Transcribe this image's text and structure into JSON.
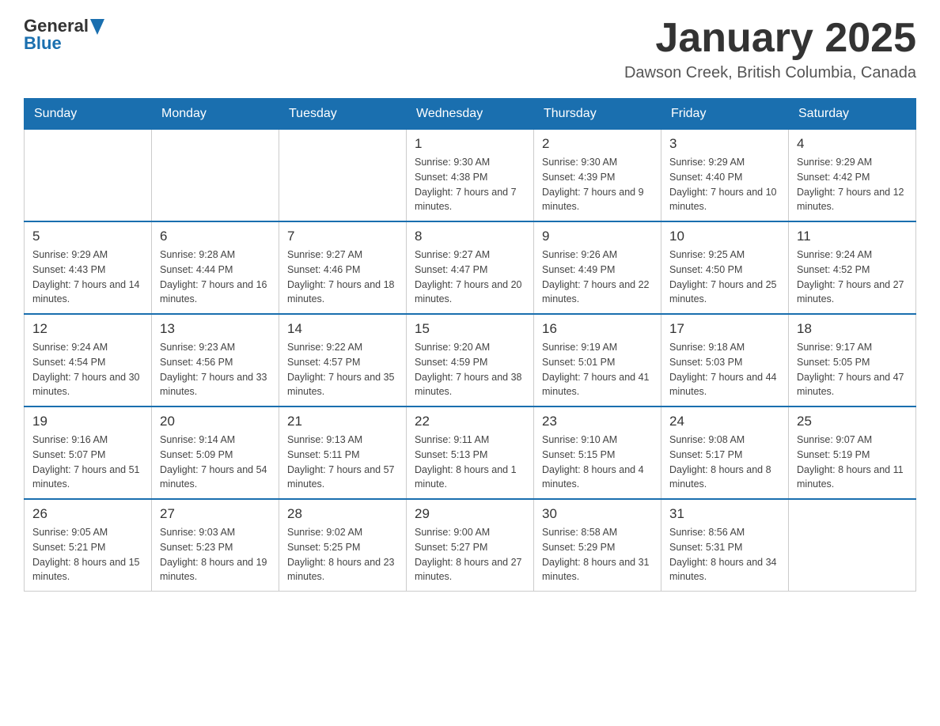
{
  "logo": {
    "text_general": "General",
    "text_blue": "Blue"
  },
  "title": "January 2025",
  "subtitle": "Dawson Creek, British Columbia, Canada",
  "days_of_week": [
    "Sunday",
    "Monday",
    "Tuesday",
    "Wednesday",
    "Thursday",
    "Friday",
    "Saturday"
  ],
  "weeks": [
    [
      {
        "num": "",
        "info": ""
      },
      {
        "num": "",
        "info": ""
      },
      {
        "num": "",
        "info": ""
      },
      {
        "num": "1",
        "info": "Sunrise: 9:30 AM\nSunset: 4:38 PM\nDaylight: 7 hours and 7 minutes."
      },
      {
        "num": "2",
        "info": "Sunrise: 9:30 AM\nSunset: 4:39 PM\nDaylight: 7 hours and 9 minutes."
      },
      {
        "num": "3",
        "info": "Sunrise: 9:29 AM\nSunset: 4:40 PM\nDaylight: 7 hours and 10 minutes."
      },
      {
        "num": "4",
        "info": "Sunrise: 9:29 AM\nSunset: 4:42 PM\nDaylight: 7 hours and 12 minutes."
      }
    ],
    [
      {
        "num": "5",
        "info": "Sunrise: 9:29 AM\nSunset: 4:43 PM\nDaylight: 7 hours and 14 minutes."
      },
      {
        "num": "6",
        "info": "Sunrise: 9:28 AM\nSunset: 4:44 PM\nDaylight: 7 hours and 16 minutes."
      },
      {
        "num": "7",
        "info": "Sunrise: 9:27 AM\nSunset: 4:46 PM\nDaylight: 7 hours and 18 minutes."
      },
      {
        "num": "8",
        "info": "Sunrise: 9:27 AM\nSunset: 4:47 PM\nDaylight: 7 hours and 20 minutes."
      },
      {
        "num": "9",
        "info": "Sunrise: 9:26 AM\nSunset: 4:49 PM\nDaylight: 7 hours and 22 minutes."
      },
      {
        "num": "10",
        "info": "Sunrise: 9:25 AM\nSunset: 4:50 PM\nDaylight: 7 hours and 25 minutes."
      },
      {
        "num": "11",
        "info": "Sunrise: 9:24 AM\nSunset: 4:52 PM\nDaylight: 7 hours and 27 minutes."
      }
    ],
    [
      {
        "num": "12",
        "info": "Sunrise: 9:24 AM\nSunset: 4:54 PM\nDaylight: 7 hours and 30 minutes."
      },
      {
        "num": "13",
        "info": "Sunrise: 9:23 AM\nSunset: 4:56 PM\nDaylight: 7 hours and 33 minutes."
      },
      {
        "num": "14",
        "info": "Sunrise: 9:22 AM\nSunset: 4:57 PM\nDaylight: 7 hours and 35 minutes."
      },
      {
        "num": "15",
        "info": "Sunrise: 9:20 AM\nSunset: 4:59 PM\nDaylight: 7 hours and 38 minutes."
      },
      {
        "num": "16",
        "info": "Sunrise: 9:19 AM\nSunset: 5:01 PM\nDaylight: 7 hours and 41 minutes."
      },
      {
        "num": "17",
        "info": "Sunrise: 9:18 AM\nSunset: 5:03 PM\nDaylight: 7 hours and 44 minutes."
      },
      {
        "num": "18",
        "info": "Sunrise: 9:17 AM\nSunset: 5:05 PM\nDaylight: 7 hours and 47 minutes."
      }
    ],
    [
      {
        "num": "19",
        "info": "Sunrise: 9:16 AM\nSunset: 5:07 PM\nDaylight: 7 hours and 51 minutes."
      },
      {
        "num": "20",
        "info": "Sunrise: 9:14 AM\nSunset: 5:09 PM\nDaylight: 7 hours and 54 minutes."
      },
      {
        "num": "21",
        "info": "Sunrise: 9:13 AM\nSunset: 5:11 PM\nDaylight: 7 hours and 57 minutes."
      },
      {
        "num": "22",
        "info": "Sunrise: 9:11 AM\nSunset: 5:13 PM\nDaylight: 8 hours and 1 minute."
      },
      {
        "num": "23",
        "info": "Sunrise: 9:10 AM\nSunset: 5:15 PM\nDaylight: 8 hours and 4 minutes."
      },
      {
        "num": "24",
        "info": "Sunrise: 9:08 AM\nSunset: 5:17 PM\nDaylight: 8 hours and 8 minutes."
      },
      {
        "num": "25",
        "info": "Sunrise: 9:07 AM\nSunset: 5:19 PM\nDaylight: 8 hours and 11 minutes."
      }
    ],
    [
      {
        "num": "26",
        "info": "Sunrise: 9:05 AM\nSunset: 5:21 PM\nDaylight: 8 hours and 15 minutes."
      },
      {
        "num": "27",
        "info": "Sunrise: 9:03 AM\nSunset: 5:23 PM\nDaylight: 8 hours and 19 minutes."
      },
      {
        "num": "28",
        "info": "Sunrise: 9:02 AM\nSunset: 5:25 PM\nDaylight: 8 hours and 23 minutes."
      },
      {
        "num": "29",
        "info": "Sunrise: 9:00 AM\nSunset: 5:27 PM\nDaylight: 8 hours and 27 minutes."
      },
      {
        "num": "30",
        "info": "Sunrise: 8:58 AM\nSunset: 5:29 PM\nDaylight: 8 hours and 31 minutes."
      },
      {
        "num": "31",
        "info": "Sunrise: 8:56 AM\nSunset: 5:31 PM\nDaylight: 8 hours and 34 minutes."
      },
      {
        "num": "",
        "info": ""
      }
    ]
  ]
}
